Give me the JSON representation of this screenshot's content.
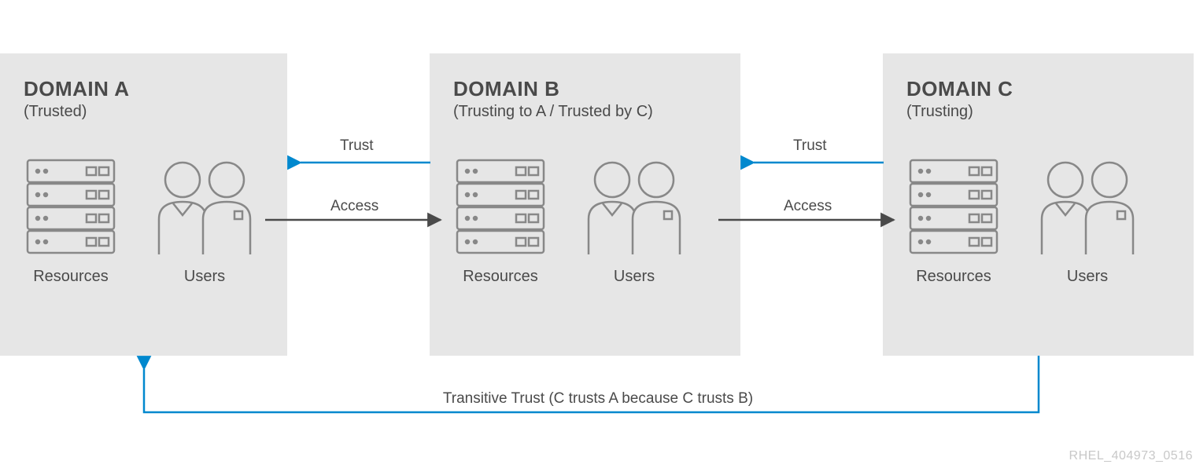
{
  "domains": {
    "a": {
      "title": "DOMAIN A",
      "sub": "(Trusted)",
      "resources": "Resources",
      "users": "Users"
    },
    "b": {
      "title": "DOMAIN B",
      "sub": "(Trusting to A / Trusted by C)",
      "resources": "Resources",
      "users": "Users"
    },
    "c": {
      "title": "DOMAIN C",
      "sub": "(Trusting)",
      "resources": "Resources",
      "users": "Users"
    }
  },
  "arrows": {
    "trust_ab": "Trust",
    "access_ab": "Access",
    "trust_bc": "Trust",
    "access_bc": "Access",
    "transitive": "Transitive Trust (C trusts A because C trusts B)"
  },
  "footer": "RHEL_404973_0516"
}
